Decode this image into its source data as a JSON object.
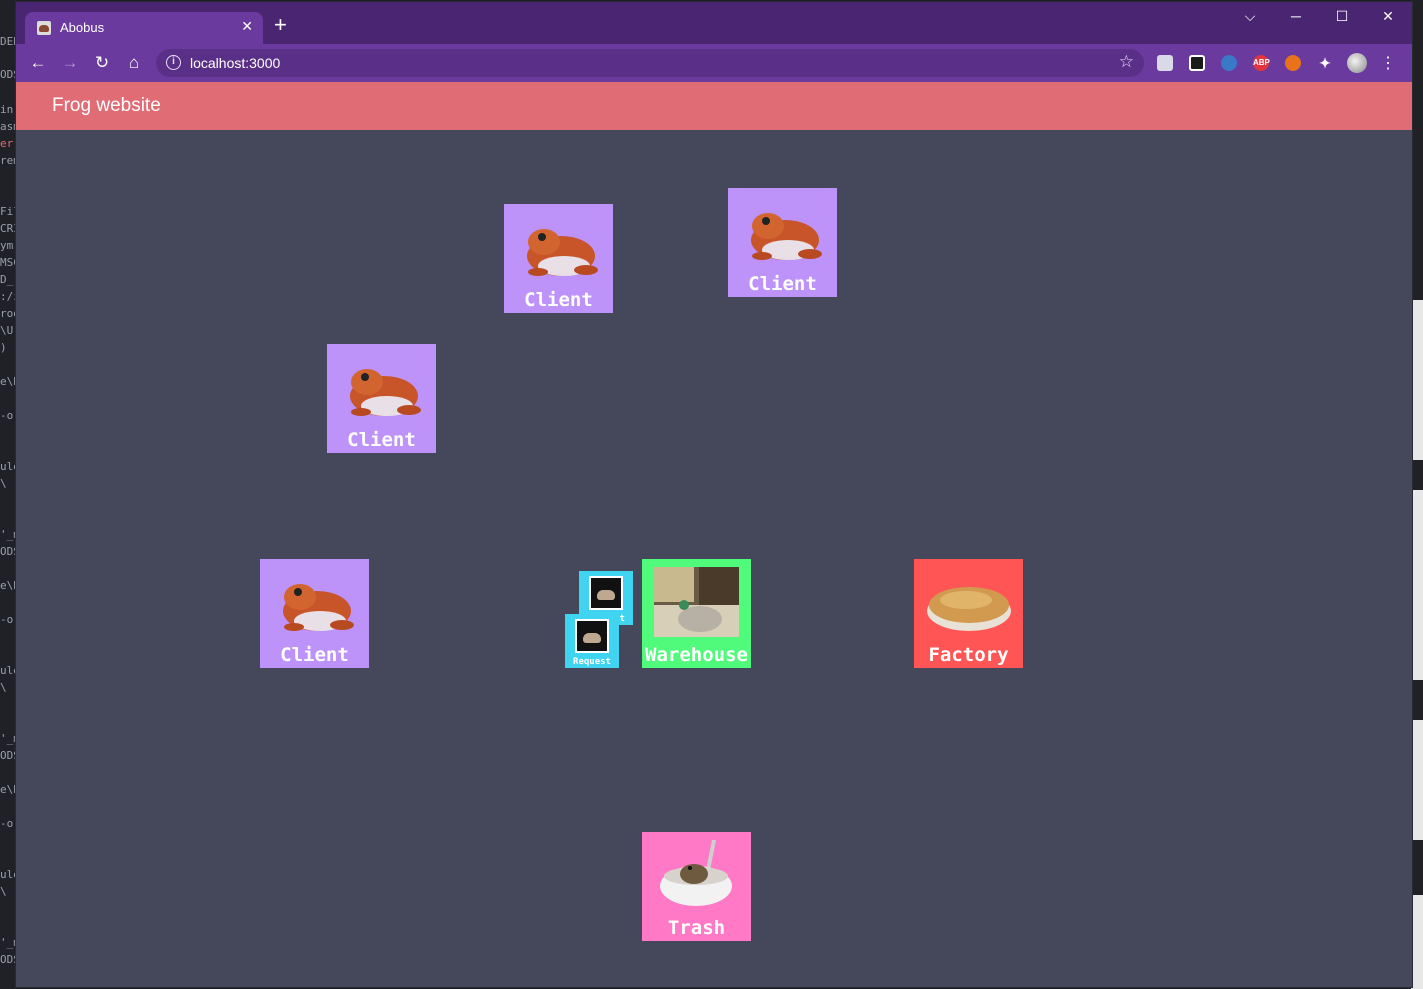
{
  "browser": {
    "tab_title": "Abobus",
    "tab_close": "✕",
    "new_tab": "+",
    "url": "localhost:3000",
    "controls": {
      "tab_search": "⌵",
      "minimize": "─",
      "maximize": "☐",
      "close": "✕"
    },
    "extensions": [
      "card-icon",
      "qr-icon",
      "eyes-icon",
      "abp-icon",
      "fox-icon",
      "puzzle-icon"
    ],
    "abp_label": "ABP"
  },
  "app": {
    "title": "Frog website",
    "colors": {
      "header": "#e06c75",
      "background": "#45475a",
      "client": "#bd93f9",
      "warehouse": "#50fa7b",
      "factory": "#ff5555",
      "trash": "#ff79c6",
      "request": "#40d4f0"
    },
    "nodes": {
      "client_1": {
        "label": "Client"
      },
      "client_2": {
        "label": "Client"
      },
      "client_3": {
        "label": "Client"
      },
      "client_4": {
        "label": "Client"
      },
      "warehouse": {
        "label": "Warehouse"
      },
      "factory": {
        "label": "Factory"
      },
      "trash": {
        "label": "Trash"
      }
    },
    "requests": [
      {
        "label": "Request"
      },
      {
        "label": "Request"
      }
    ]
  }
}
